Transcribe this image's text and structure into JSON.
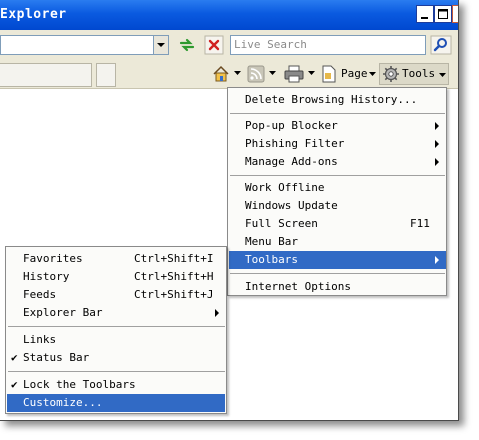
{
  "window": {
    "title": "Explorer"
  },
  "address_bar": {
    "search_placeholder": "Live Search"
  },
  "command_bar": {
    "page_label": "Page",
    "tools_label": "Tools"
  },
  "tools_menu": {
    "items": [
      {
        "label": "Delete Browsing History...",
        "mnemonic": "D"
      },
      {
        "label": "Pop-up Blocker",
        "has_submenu": true
      },
      {
        "label": "Phishing Filter",
        "has_submenu": true
      },
      {
        "label": "Manage Add-ons",
        "has_submenu": true
      },
      {
        "label": "Work Offline"
      },
      {
        "label": "Windows Update"
      },
      {
        "label": "Full Screen",
        "shortcut": "F11"
      },
      {
        "label": "Menu Bar"
      },
      {
        "label": "Toolbars",
        "has_submenu": true,
        "highlighted": true
      },
      {
        "label": "Internet Options"
      }
    ]
  },
  "toolbars_submenu": {
    "items": [
      {
        "label": "Favorites",
        "shortcut": "Ctrl+Shift+I"
      },
      {
        "label": "History",
        "shortcut": "Ctrl+Shift+H"
      },
      {
        "label": "Feeds",
        "shortcut": "Ctrl+Shift+J"
      },
      {
        "label": "Explorer Bar",
        "has_submenu": true
      },
      {
        "label": "Links"
      },
      {
        "label": "Status Bar",
        "checked": true
      },
      {
        "label": "Lock the Toolbars",
        "checked": true
      },
      {
        "label": "Customize...",
        "highlighted": true
      }
    ]
  },
  "colors": {
    "titlebar": "#0a5ae0",
    "menu_highlight": "#316ac5",
    "chrome": "#ece9d8"
  }
}
